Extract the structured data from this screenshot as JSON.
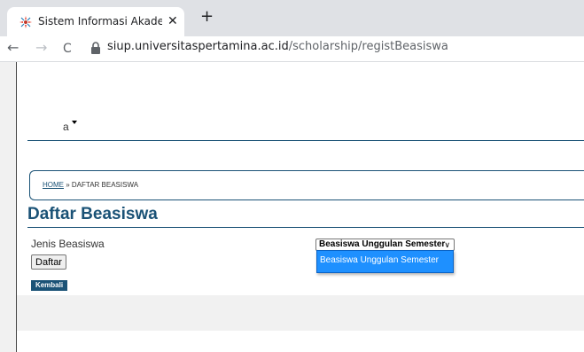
{
  "browser": {
    "tab_title": "Sistem Informasi Akademik - Reg",
    "tab_close": "✕",
    "new_tab": "+",
    "nav_back": "←",
    "nav_forward": "→",
    "nav_reload": "C",
    "url_domain": "siup.universitaspertamina.ac.id",
    "url_path": "/scholarship/registBeasiswa"
  },
  "header": {
    "user_label": "a"
  },
  "breadcrumb": {
    "home": "HOME",
    "separator": " » ",
    "current": "DAFTAR BEASISWA"
  },
  "page": {
    "title": "Daftar Beasiswa",
    "jenis_label": "Jenis Beasiswa",
    "selected_option": "Beasiswa Unggulan Semester",
    "options": [
      "Beasiswa Unggulan Semester"
    ],
    "daftar_button": "Daftar",
    "kembali_button": "Kembali"
  },
  "colors": {
    "primary": "#1a5276",
    "dropdown_highlight": "#1e90ff"
  }
}
